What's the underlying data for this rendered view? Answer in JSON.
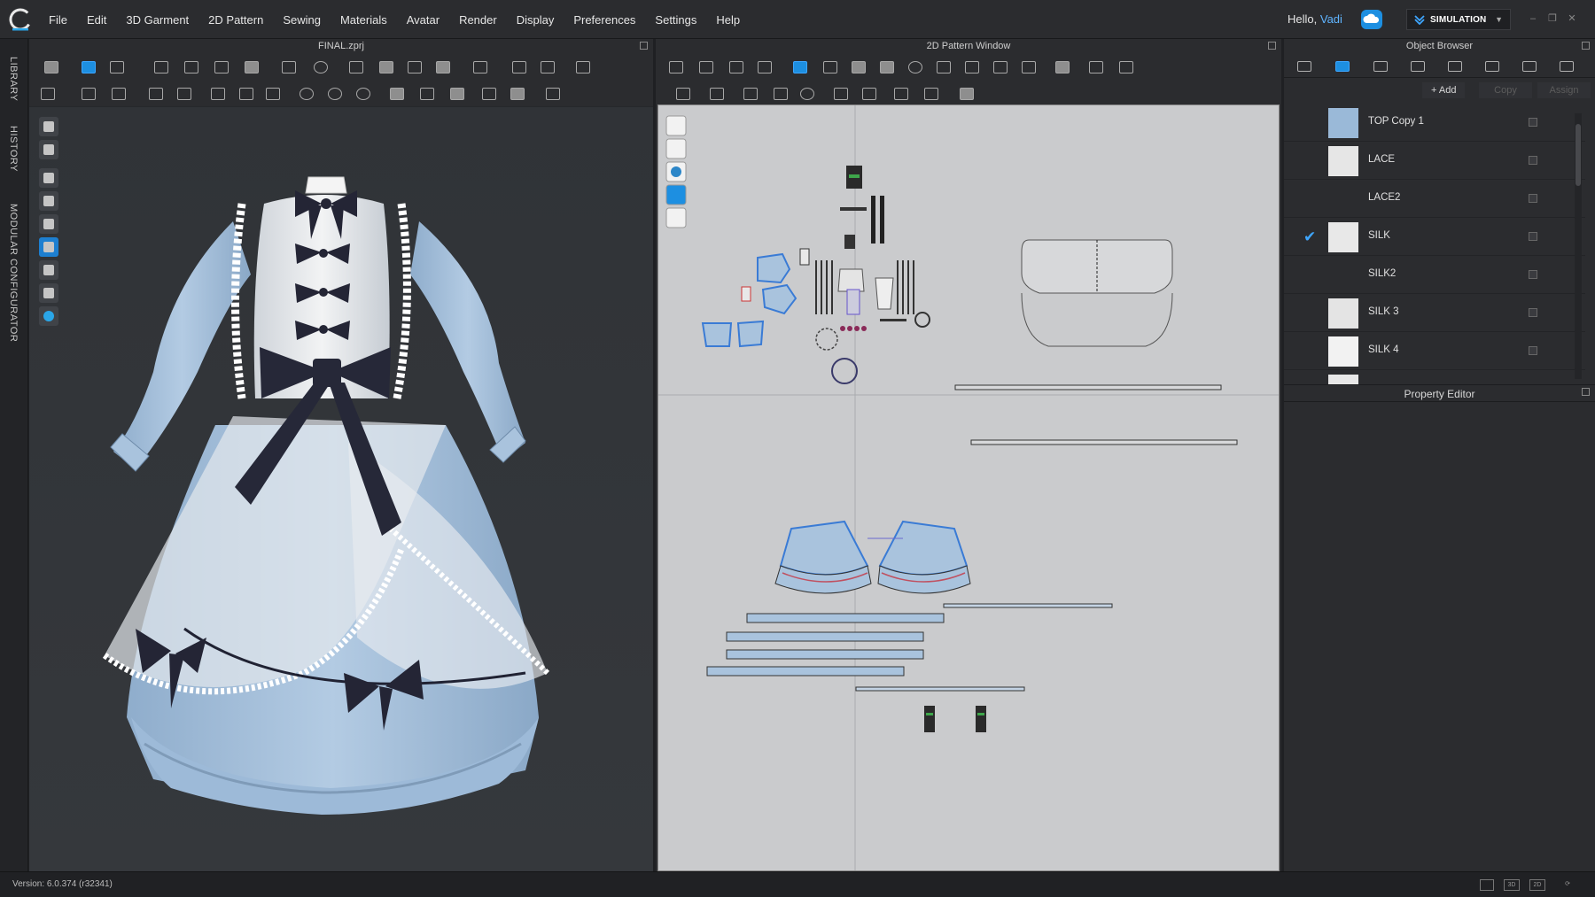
{
  "app": {
    "menu": [
      "File",
      "Edit",
      "3D Garment",
      "2D Pattern",
      "Sewing",
      "Materials",
      "Avatar",
      "Render",
      "Display",
      "Preferences",
      "Settings",
      "Help"
    ],
    "greeting": "Hello,",
    "username": "Vadi",
    "mode": "SIMULATION"
  },
  "left_tabs": [
    "LIBRARY",
    "HISTORY",
    "MODULAR CONFIGURATOR"
  ],
  "view3d": {
    "title": "FINAL.zprj"
  },
  "view2d": {
    "title": "2D Pattern Window"
  },
  "object_browser": {
    "title": "Object Browser",
    "actions": {
      "add": "+ Add",
      "copy": "Copy",
      "assign": "Assign"
    },
    "fabrics": [
      {
        "name": "TOP Copy 1",
        "swatch": "#9ab9d8",
        "checked": false
      },
      {
        "name": "LACE",
        "swatch": "#e6e6e6",
        "checked": false
      },
      {
        "name": "LACE2",
        "swatch": "",
        "checked": false
      },
      {
        "name": "SILK",
        "swatch": "#e8e8e8",
        "checked": true
      },
      {
        "name": "SILK2",
        "swatch": "",
        "checked": false
      },
      {
        "name": "SILK 3",
        "swatch": "#e4e4e4",
        "checked": false
      },
      {
        "name": "SILK 4",
        "swatch": "#f2f2f2",
        "checked": false
      },
      {
        "name": "",
        "swatch": "#e8e8e8",
        "checked": false
      }
    ]
  },
  "property_editor": {
    "title": "Property Editor"
  },
  "status": {
    "version": "Version: 6.0.374 (r32341)"
  },
  "colors": {
    "accent": "#1d8fe1",
    "dress_blue": "#a9c3dd",
    "bow_navy": "#242535",
    "canvas": "#cacbcd"
  }
}
